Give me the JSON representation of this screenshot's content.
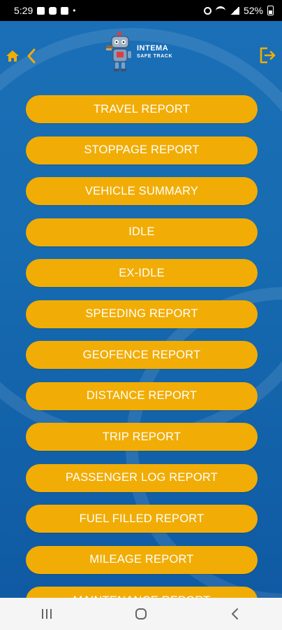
{
  "status_bar": {
    "time": "5:29",
    "dot": "•",
    "battery": "52%"
  },
  "header": {
    "brand": "INTEMA",
    "brand_sub": "SAFE TRACK"
  },
  "menu": {
    "items": [
      "TRAVEL REPORT",
      "STOPPAGE REPORT",
      "VEHICLE SUMMARY",
      "IDLE",
      "EX-IDLE",
      "SPEEDING REPORT",
      "GEOFENCE REPORT",
      "DISTANCE REPORT",
      "TRIP REPORT",
      "PASSENGER LOG REPORT",
      "FUEL FILLED REPORT",
      "MILEAGE REPORT",
      "MAINTENANCE REPORT"
    ]
  },
  "colors": {
    "background": "#176bb0",
    "button": "#f1ad05",
    "accent": "#f1ad05"
  },
  "icons": [
    "home-icon",
    "back-icon",
    "logout-icon",
    "recents-icon",
    "home-nav-icon",
    "back-nav-icon"
  ]
}
